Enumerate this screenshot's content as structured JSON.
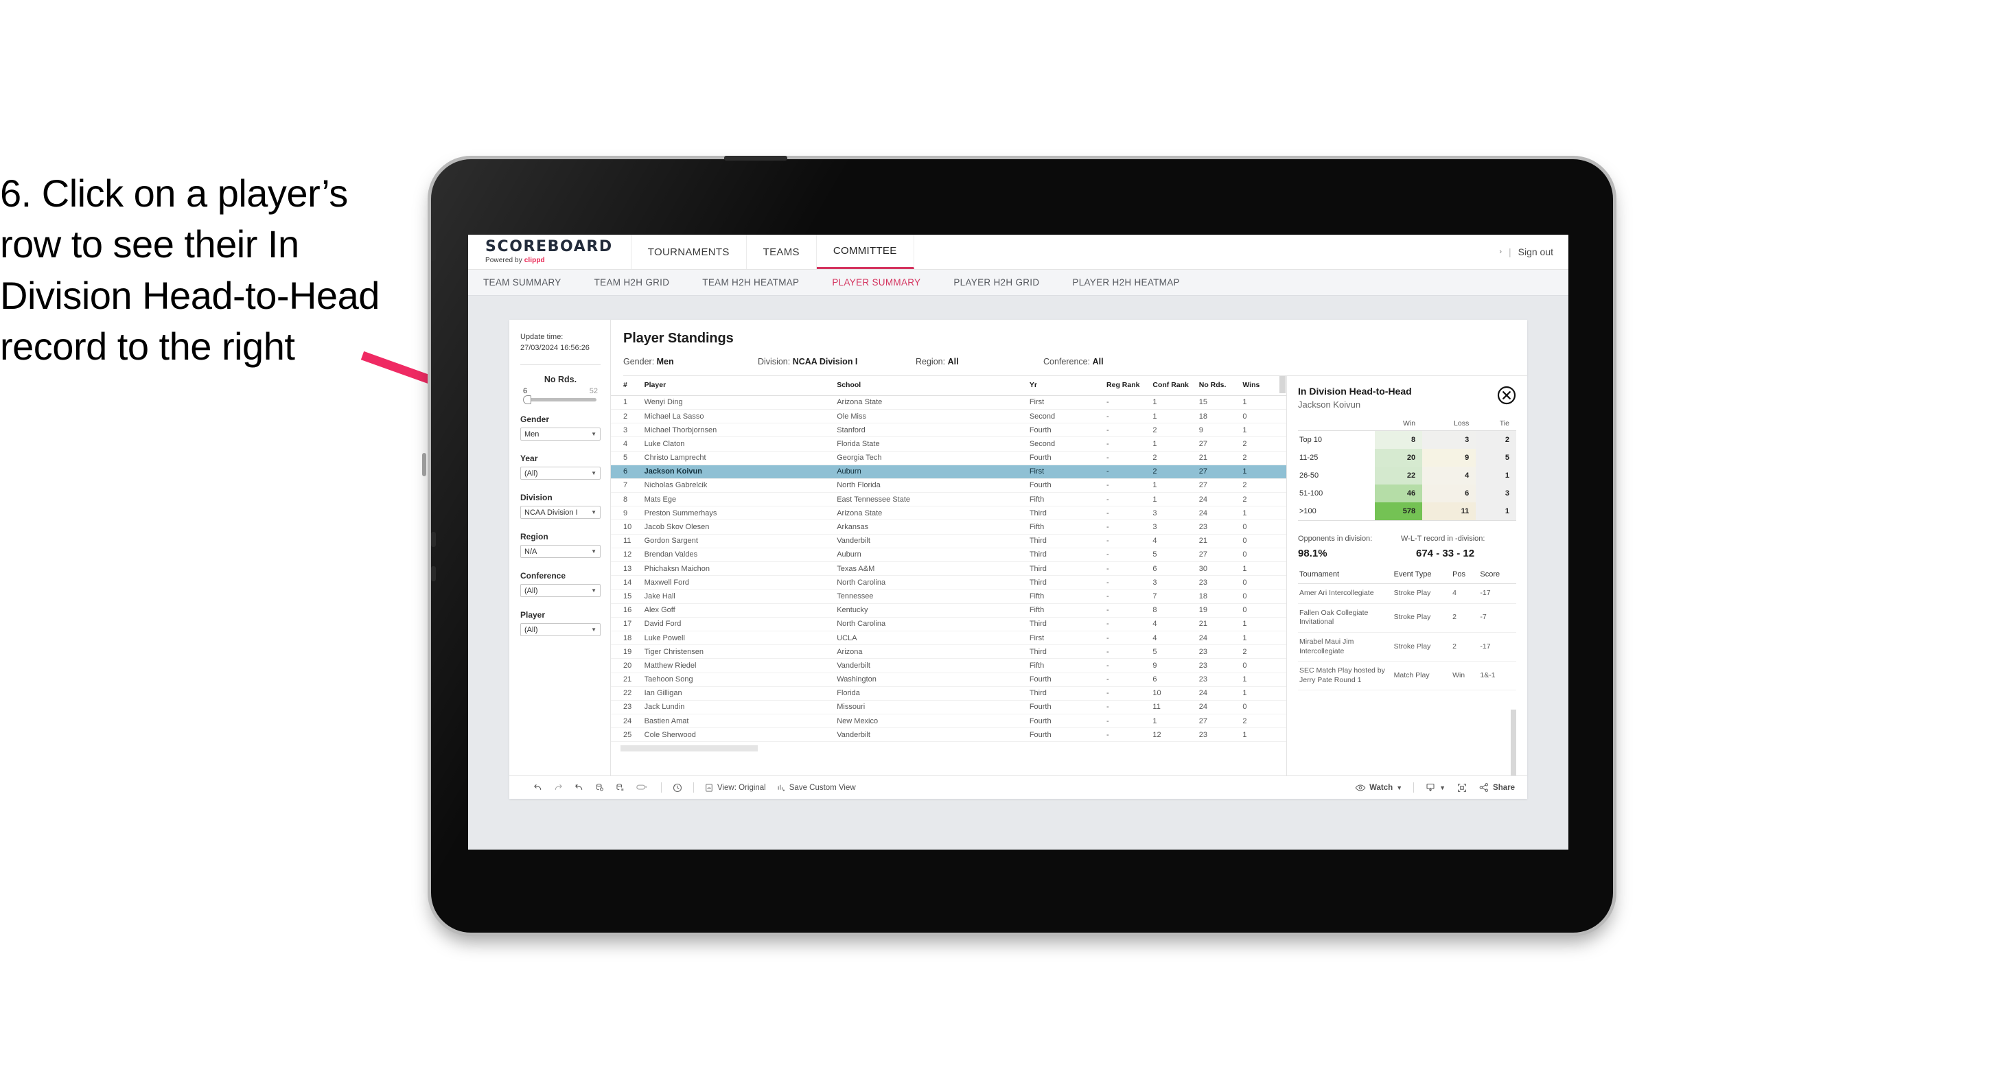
{
  "instruction": {
    "text": "6. Click on a player’s row to see their In Division Head-to-Head record to the right"
  },
  "colors": {
    "accent_pink": "#d4345f",
    "brand_red": "#e8204e",
    "selected_row": "#8fc0d4",
    "heat_green": "#6fc04a",
    "arrow": "#ef2a63"
  },
  "app": {
    "brand": {
      "title": "SCOREBOARD",
      "powered_prefix": "Powered by ",
      "powered_brand": "clippd"
    },
    "nav_main": [
      {
        "label": "TOURNAMENTS",
        "active": false
      },
      {
        "label": "TEAMS",
        "active": false
      },
      {
        "label": "COMMITTEE",
        "active": true
      }
    ],
    "topbar_right": {
      "chevron": "›",
      "separator": "|",
      "sign_out": "Sign out"
    },
    "subnav": [
      {
        "label": "TEAM SUMMARY",
        "active": false
      },
      {
        "label": "TEAM H2H GRID",
        "active": false
      },
      {
        "label": "TEAM H2H HEATMAP",
        "active": false
      },
      {
        "label": "PLAYER SUMMARY",
        "active": true
      },
      {
        "label": "PLAYER H2H GRID",
        "active": false
      },
      {
        "label": "PLAYER H2H HEATMAP",
        "active": false
      }
    ]
  },
  "filters": {
    "update_time_label": "Update time:",
    "update_time_value": "27/03/2024 16:56:26",
    "slider": {
      "title": "No Rds.",
      "min": "6",
      "max": "52"
    },
    "groups": [
      {
        "title": "Gender",
        "value": "Men"
      },
      {
        "title": "Year",
        "value": "(All)"
      },
      {
        "title": "Division",
        "value": "NCAA Division I"
      },
      {
        "title": "Region",
        "value": "N/A"
      },
      {
        "title": "Conference",
        "value": "(All)"
      },
      {
        "title": "Player",
        "value": "(All)"
      }
    ]
  },
  "standings": {
    "title": "Player Standings",
    "meta": [
      {
        "label": "Gender: ",
        "value": "Men"
      },
      {
        "label": "Division: ",
        "value": "NCAA Division I"
      },
      {
        "label": "Region: ",
        "value": "All"
      },
      {
        "label": "Conference: ",
        "value": "All"
      }
    ],
    "columns": [
      "#",
      "Player",
      "School",
      "Yr",
      "Reg Rank",
      "Conf Rank",
      "No Rds.",
      "Wins"
    ],
    "rows": [
      {
        "num": "1",
        "player": "Wenyi Ding",
        "school": "Arizona State",
        "yr": "First",
        "reg": "-",
        "conf": "1",
        "rds": "15",
        "wins": "1",
        "selected": false
      },
      {
        "num": "2",
        "player": "Michael La Sasso",
        "school": "Ole Miss",
        "yr": "Second",
        "reg": "-",
        "conf": "1",
        "rds": "18",
        "wins": "0",
        "selected": false
      },
      {
        "num": "3",
        "player": "Michael Thorbjornsen",
        "school": "Stanford",
        "yr": "Fourth",
        "reg": "-",
        "conf": "2",
        "rds": "9",
        "wins": "1",
        "selected": false
      },
      {
        "num": "4",
        "player": "Luke Claton",
        "school": "Florida State",
        "yr": "Second",
        "reg": "-",
        "conf": "1",
        "rds": "27",
        "wins": "2",
        "selected": false
      },
      {
        "num": "5",
        "player": "Christo Lamprecht",
        "school": "Georgia Tech",
        "yr": "Fourth",
        "reg": "-",
        "conf": "2",
        "rds": "21",
        "wins": "2",
        "selected": false
      },
      {
        "num": "6",
        "player": "Jackson Koivun",
        "school": "Auburn",
        "yr": "First",
        "reg": "-",
        "conf": "2",
        "rds": "27",
        "wins": "1",
        "selected": true
      },
      {
        "num": "7",
        "player": "Nicholas Gabrelcik",
        "school": "North Florida",
        "yr": "Fourth",
        "reg": "-",
        "conf": "1",
        "rds": "27",
        "wins": "2",
        "selected": false
      },
      {
        "num": "8",
        "player": "Mats Ege",
        "school": "East Tennessee State",
        "yr": "Fifth",
        "reg": "-",
        "conf": "1",
        "rds": "24",
        "wins": "2",
        "selected": false
      },
      {
        "num": "9",
        "player": "Preston Summerhays",
        "school": "Arizona State",
        "yr": "Third",
        "reg": "-",
        "conf": "3",
        "rds": "24",
        "wins": "1",
        "selected": false
      },
      {
        "num": "10",
        "player": "Jacob Skov Olesen",
        "school": "Arkansas",
        "yr": "Fifth",
        "reg": "-",
        "conf": "3",
        "rds": "23",
        "wins": "0",
        "selected": false
      },
      {
        "num": "11",
        "player": "Gordon Sargent",
        "school": "Vanderbilt",
        "yr": "Third",
        "reg": "-",
        "conf": "4",
        "rds": "21",
        "wins": "0",
        "selected": false
      },
      {
        "num": "12",
        "player": "Brendan Valdes",
        "school": "Auburn",
        "yr": "Third",
        "reg": "-",
        "conf": "5",
        "rds": "27",
        "wins": "0",
        "selected": false
      },
      {
        "num": "13",
        "player": "Phichaksn Maichon",
        "school": "Texas A&M",
        "yr": "Third",
        "reg": "-",
        "conf": "6",
        "rds": "30",
        "wins": "1",
        "selected": false
      },
      {
        "num": "14",
        "player": "Maxwell Ford",
        "school": "North Carolina",
        "yr": "Third",
        "reg": "-",
        "conf": "3",
        "rds": "23",
        "wins": "0",
        "selected": false
      },
      {
        "num": "15",
        "player": "Jake Hall",
        "school": "Tennessee",
        "yr": "Fifth",
        "reg": "-",
        "conf": "7",
        "rds": "18",
        "wins": "0",
        "selected": false
      },
      {
        "num": "16",
        "player": "Alex Goff",
        "school": "Kentucky",
        "yr": "Fifth",
        "reg": "-",
        "conf": "8",
        "rds": "19",
        "wins": "0",
        "selected": false
      },
      {
        "num": "17",
        "player": "David Ford",
        "school": "North Carolina",
        "yr": "Third",
        "reg": "-",
        "conf": "4",
        "rds": "21",
        "wins": "1",
        "selected": false
      },
      {
        "num": "18",
        "player": "Luke Powell",
        "school": "UCLA",
        "yr": "First",
        "reg": "-",
        "conf": "4",
        "rds": "24",
        "wins": "1",
        "selected": false
      },
      {
        "num": "19",
        "player": "Tiger Christensen",
        "school": "Arizona",
        "yr": "Third",
        "reg": "-",
        "conf": "5",
        "rds": "23",
        "wins": "2",
        "selected": false
      },
      {
        "num": "20",
        "player": "Matthew Riedel",
        "school": "Vanderbilt",
        "yr": "Fifth",
        "reg": "-",
        "conf": "9",
        "rds": "23",
        "wins": "0",
        "selected": false
      },
      {
        "num": "21",
        "player": "Taehoon Song",
        "school": "Washington",
        "yr": "Fourth",
        "reg": "-",
        "conf": "6",
        "rds": "23",
        "wins": "1",
        "selected": false
      },
      {
        "num": "22",
        "player": "Ian Gilligan",
        "school": "Florida",
        "yr": "Third",
        "reg": "-",
        "conf": "10",
        "rds": "24",
        "wins": "1",
        "selected": false
      },
      {
        "num": "23",
        "player": "Jack Lundin",
        "school": "Missouri",
        "yr": "Fourth",
        "reg": "-",
        "conf": "11",
        "rds": "24",
        "wins": "0",
        "selected": false
      },
      {
        "num": "24",
        "player": "Bastien Amat",
        "school": "New Mexico",
        "yr": "Fourth",
        "reg": "-",
        "conf": "1",
        "rds": "27",
        "wins": "2",
        "selected": false
      },
      {
        "num": "25",
        "player": "Cole Sherwood",
        "school": "Vanderbilt",
        "yr": "Fourth",
        "reg": "-",
        "conf": "12",
        "rds": "23",
        "wins": "1",
        "selected": false
      }
    ]
  },
  "h2h": {
    "title": "In Division Head-to-Head",
    "player": "Jackson Koivun",
    "close_icon": "close-circle-icon",
    "matrix": {
      "columns": [
        "Win",
        "Loss",
        "Tie"
      ],
      "rows": [
        {
          "label": "Top 10",
          "win": "8",
          "loss": "3",
          "tie": "2",
          "win_color": "#e9f2e5",
          "loss_color": "#f0f0ee",
          "tie_color": "#efefef"
        },
        {
          "label": "11-25",
          "win": "20",
          "loss": "9",
          "tie": "5",
          "win_color": "#d6ead0",
          "loss_color": "#f6f3e4",
          "tie_color": "#efefef"
        },
        {
          "label": "26-50",
          "win": "22",
          "loss": "4",
          "tie": "1",
          "win_color": "#d4e9ce",
          "loss_color": "#f4f2ea",
          "tie_color": "#efefef"
        },
        {
          "label": "51-100",
          "win": "46",
          "loss": "6",
          "tie": "3",
          "win_color": "#b5dda7",
          "loss_color": "#f4f1e8",
          "tie_color": "#efefef"
        },
        {
          "label": ">100",
          "win": "578",
          "loss": "11",
          "tie": "1",
          "win_color": "#74c254",
          "loss_color": "#f3eddc",
          "tie_color": "#efefef"
        }
      ]
    },
    "stats": [
      {
        "label": "Opponents in division:",
        "value": "98.1%"
      },
      {
        "label": "W-L-T record in -division:",
        "value": "674 - 33 - 12"
      }
    ],
    "tournaments": {
      "columns": [
        "Tournament",
        "Event Type",
        "Pos",
        "Score"
      ],
      "rows": [
        {
          "name": "Amer Ari Intercollegiate",
          "type": "Stroke Play",
          "pos": "4",
          "score": "-17"
        },
        {
          "name": "Fallen Oak Collegiate Invitational",
          "type": "Stroke Play",
          "pos": "2",
          "score": "-7"
        },
        {
          "name": "Mirabel Maui Jim Intercollegiate",
          "type": "Stroke Play",
          "pos": "2",
          "score": "-17"
        },
        {
          "name": "SEC Match Play hosted by Jerry Pate Round 1",
          "type": "Match Play",
          "pos": "Win",
          "score": "1&-1"
        }
      ]
    }
  },
  "toolbar": {
    "left": [
      {
        "icon": "undo-icon",
        "label": ""
      },
      {
        "icon": "redo-icon",
        "label": ""
      },
      {
        "icon": "revert-icon",
        "label": ""
      },
      {
        "icon": "refresh-data-icon",
        "label": ""
      },
      {
        "icon": "pause-updates-icon",
        "label": ""
      },
      {
        "icon": "highlight-icon",
        "label": ""
      },
      {
        "icon": "history-icon",
        "label": ""
      }
    ],
    "view_label": "View: Original",
    "save_view_label": "Save Custom View",
    "watch_label": "Watch",
    "share_label": "Share",
    "download_icon": "download-icon",
    "fullscreen_icon": "fullscreen-icon"
  }
}
